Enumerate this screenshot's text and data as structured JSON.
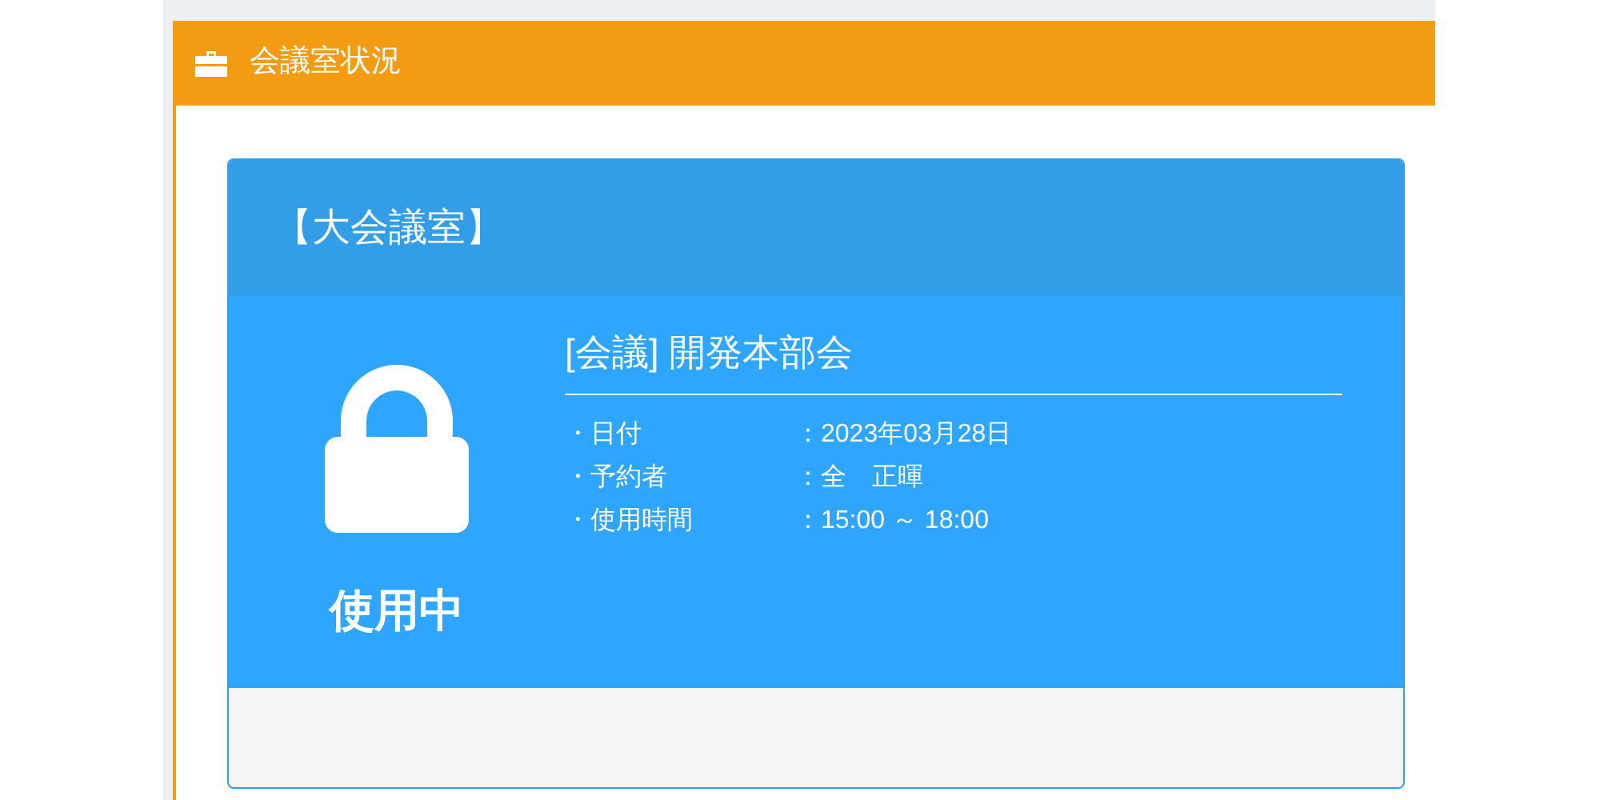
{
  "panel": {
    "title": "会議室状況"
  },
  "room": {
    "name": "【大会議室】",
    "in_use": true,
    "status_label": "使用中",
    "meeting_title": "[会議] 開発本部会",
    "details": [
      {
        "label": "・日付",
        "value": "：2023年03月28日"
      },
      {
        "label": "・予約者",
        "value": "：全　正暉"
      },
      {
        "label": "・使用時間",
        "value": "：15:00 ～ 18:00"
      }
    ]
  }
}
